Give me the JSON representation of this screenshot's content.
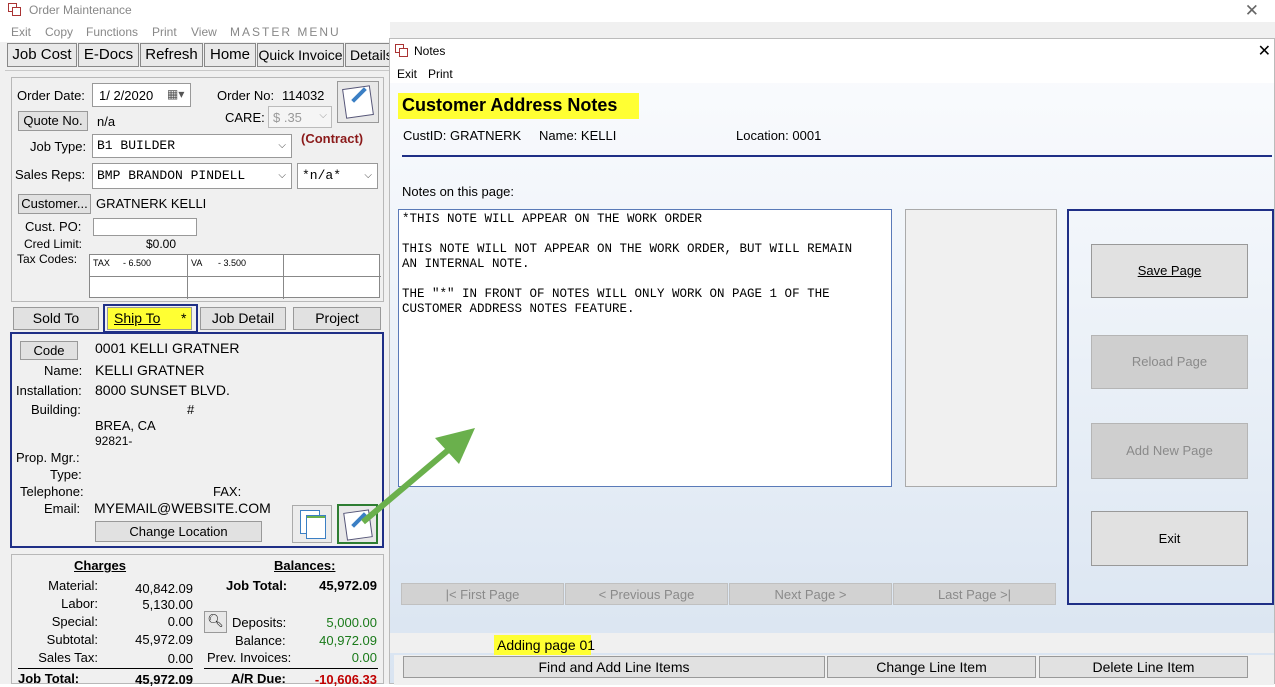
{
  "main_window": {
    "title": "Order Maintenance",
    "menu": {
      "exit": "Exit",
      "copy": "Copy",
      "functions": "Functions",
      "print": "Print",
      "view": "View",
      "master_menu": "MASTER MENU"
    },
    "toolbar": {
      "job_cost": "Job Cost",
      "e_docs": "E-Docs",
      "refresh": "Refresh",
      "home": "Home",
      "quick_invoice": "Quick Invoice",
      "details": "Details"
    }
  },
  "order": {
    "order_date_label": "Order Date:",
    "order_date": "1/ 2/2020",
    "order_no_label": "Order No:",
    "order_no": "114032",
    "quote_button": "Quote No.",
    "quote_value": "n/a",
    "care_label": "CARE:",
    "care_value": "$ .35",
    "job_type_label": "Job Type:",
    "job_type": "B1 BUILDER",
    "contract": "(Contract)",
    "sales_reps_label": "Sales Reps:",
    "sales_rep": "BMP BRANDON PINDELL",
    "sales_rep2": "*n/a*",
    "customer_button": "Customer...",
    "customer_value": "GRATNERK  KELLI",
    "cust_po_label": "Cust. PO:",
    "cust_po_value": "",
    "cred_limit_label": "Cred Limit:",
    "cred_limit": "$0.00",
    "tax_codes_label": "Tax Codes:",
    "tax1_code": "TAX",
    "tax1_value": "- 6.500",
    "tax2_code": "VA",
    "tax2_value": "- 3.500"
  },
  "tabs": {
    "sold_to": "Sold To",
    "ship_to": "Ship To",
    "ship_to_star": "*",
    "job_detail": "Job Detail",
    "project": "Project"
  },
  "ship_to": {
    "code_button": "Code",
    "code_value": "0001 KELLI GRATNER",
    "name_label": "Name:",
    "name": "KELLI GRATNER",
    "installation_label": "Installation:",
    "installation": "8000 SUNSET BLVD.",
    "building_label": "Building:",
    "building_hash": "#",
    "city": "BREA, CA",
    "zip": "92821-",
    "prop_mgr_label": "Prop. Mgr.:",
    "type_label": "Type:",
    "telephone_label": "Telephone:",
    "fax_label": "FAX:",
    "email_label": "Email:",
    "email": "MYEMAIL@WEBSITE.COM",
    "change_location": "Change Location"
  },
  "totals": {
    "charges_header": "Charges",
    "balances_header": "Balances:",
    "material_label": "Material:",
    "material": "40,842.09",
    "labor_label": "Labor:",
    "labor": "5,130.00",
    "special_label": "Special:",
    "special": "0.00",
    "subtotal_label": "Subtotal:",
    "subtotal": "45,972.09",
    "sales_tax_label": "Sales Tax:",
    "sales_tax": "0.00",
    "job_total_label": "Job Total:",
    "job_total": "45,972.09",
    "bal_job_total_label": "Job Total:",
    "bal_job_total": "45,972.09",
    "deposits_label": "Deposits:",
    "deposits": "5,000.00",
    "balance_label": "Balance:",
    "balance": "40,972.09",
    "prev_invoices_label": "Prev. Invoices:",
    "prev_invoices": "0.00",
    "ar_due_label": "A/R Due:",
    "ar_due": "-10,606.33",
    "colors": {
      "green": "#1a7a1a",
      "red": "#c00000"
    }
  },
  "notes_dialog": {
    "title": "Notes",
    "menu": {
      "exit": "Exit",
      "print": "Print"
    },
    "heading": "Customer Address Notes",
    "cust_id": "CustID: GRATNERK",
    "name": "Name:  KELLI",
    "location": "Location: 0001",
    "notes_label": "Notes on this page:",
    "note_lines": [
      "*THIS NOTE WILL APPEAR ON THE WORK ORDER",
      "",
      "THIS NOTE WILL NOT APPEAR ON THE WORK ORDER, BUT WILL REMAIN",
      "AN INTERNAL NOTE.",
      "",
      "THE \"*\" IN FRONT OF NOTES WILL ONLY WORK ON PAGE 1 OF THE",
      "CUSTOMER ADDRESS NOTES FEATURE."
    ],
    "save_page": "Save Page",
    "reload_page": "Reload Page",
    "add_new_page": "Add New Page",
    "exit_button": "Exit",
    "first_page": "|< First Page",
    "previous_page": "< Previous Page",
    "next_page": "Next Page >",
    "last_page": "Last Page >|",
    "status": "Adding page 01",
    "find_add_line_items": "Find and Add Line Items",
    "change_line_item": "Change Line Item",
    "delete_line_item": "Delete Line Item",
    "highlight_color": "#ffff33",
    "accent_color": "#1f2f86"
  }
}
